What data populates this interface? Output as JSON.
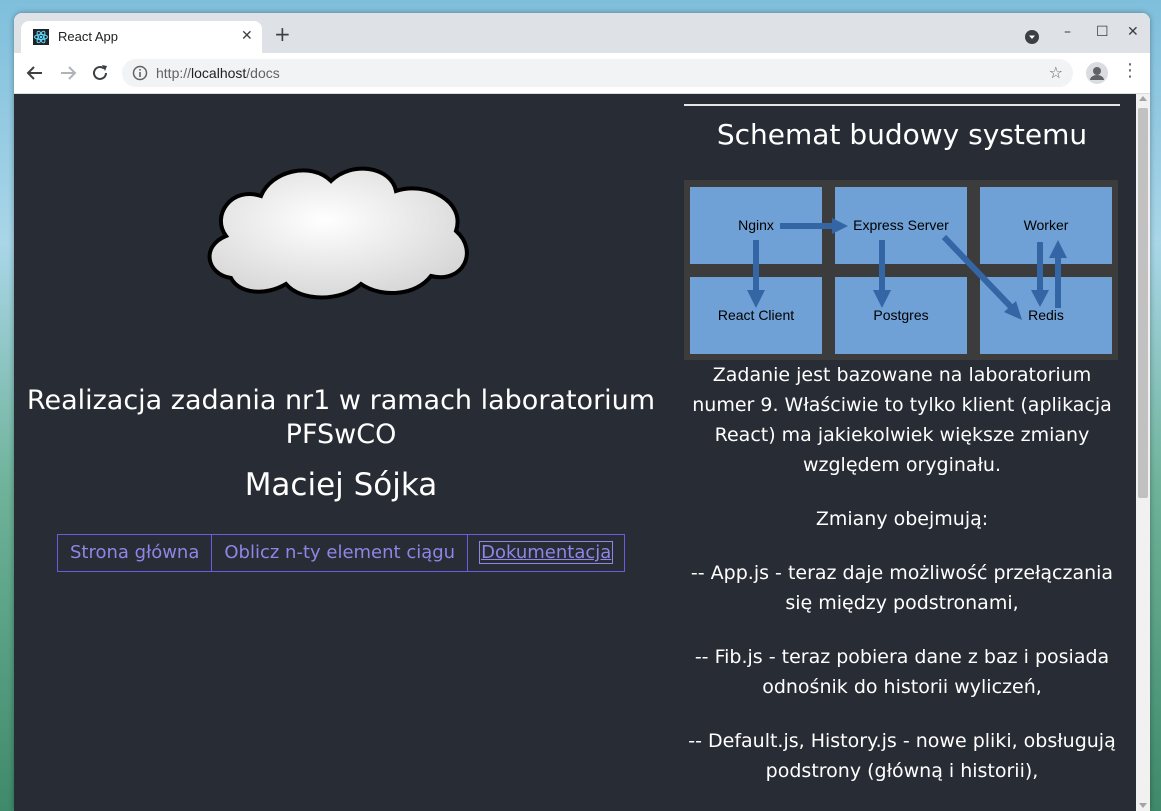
{
  "browser": {
    "tab_title": "React App",
    "url_prefix": "http://",
    "url_host": "localhost",
    "url_path": "/docs"
  },
  "page": {
    "heading": "Realizacja zadania nr1 w ramach laboratorium PFSwCO",
    "author": "Maciej Sójka",
    "nav": [
      {
        "label": "Strona główna"
      },
      {
        "label": "Oblicz n-ty element ciągu"
      },
      {
        "label": "Dokumentacja"
      }
    ],
    "docs": {
      "title": "Schemat budowy systemu",
      "diagram": {
        "nodes": [
          "Nginx",
          "Express Server",
          "Worker",
          "React Client",
          "Postgres",
          "Redis"
        ],
        "box_color": "#6fa0d6",
        "arrow_color": "#3465a4",
        "bg_color": "#3c3c3c"
      },
      "paragraphs": [
        "Zadanie jest bazowane na laboratorium numer 9. Właściwie to tylko klient (aplikacja React) ma jakiekolwiek większe zmiany względem oryginału.",
        "Zmiany obejmują:",
        "-- App.js - teraz daje możliwość przełączania się między podstronami,",
        "-- Fib.js - teraz pobiera dane z baz i posiada odnośnik do historii wyliczeń,",
        "-- Default.js, History.js - nowe pliki, obsługują podstrony (główną i historii),"
      ]
    }
  },
  "colors": {
    "page_bg": "#282c34",
    "link": "#8e86e6",
    "link_border": "#6a5ce0"
  }
}
